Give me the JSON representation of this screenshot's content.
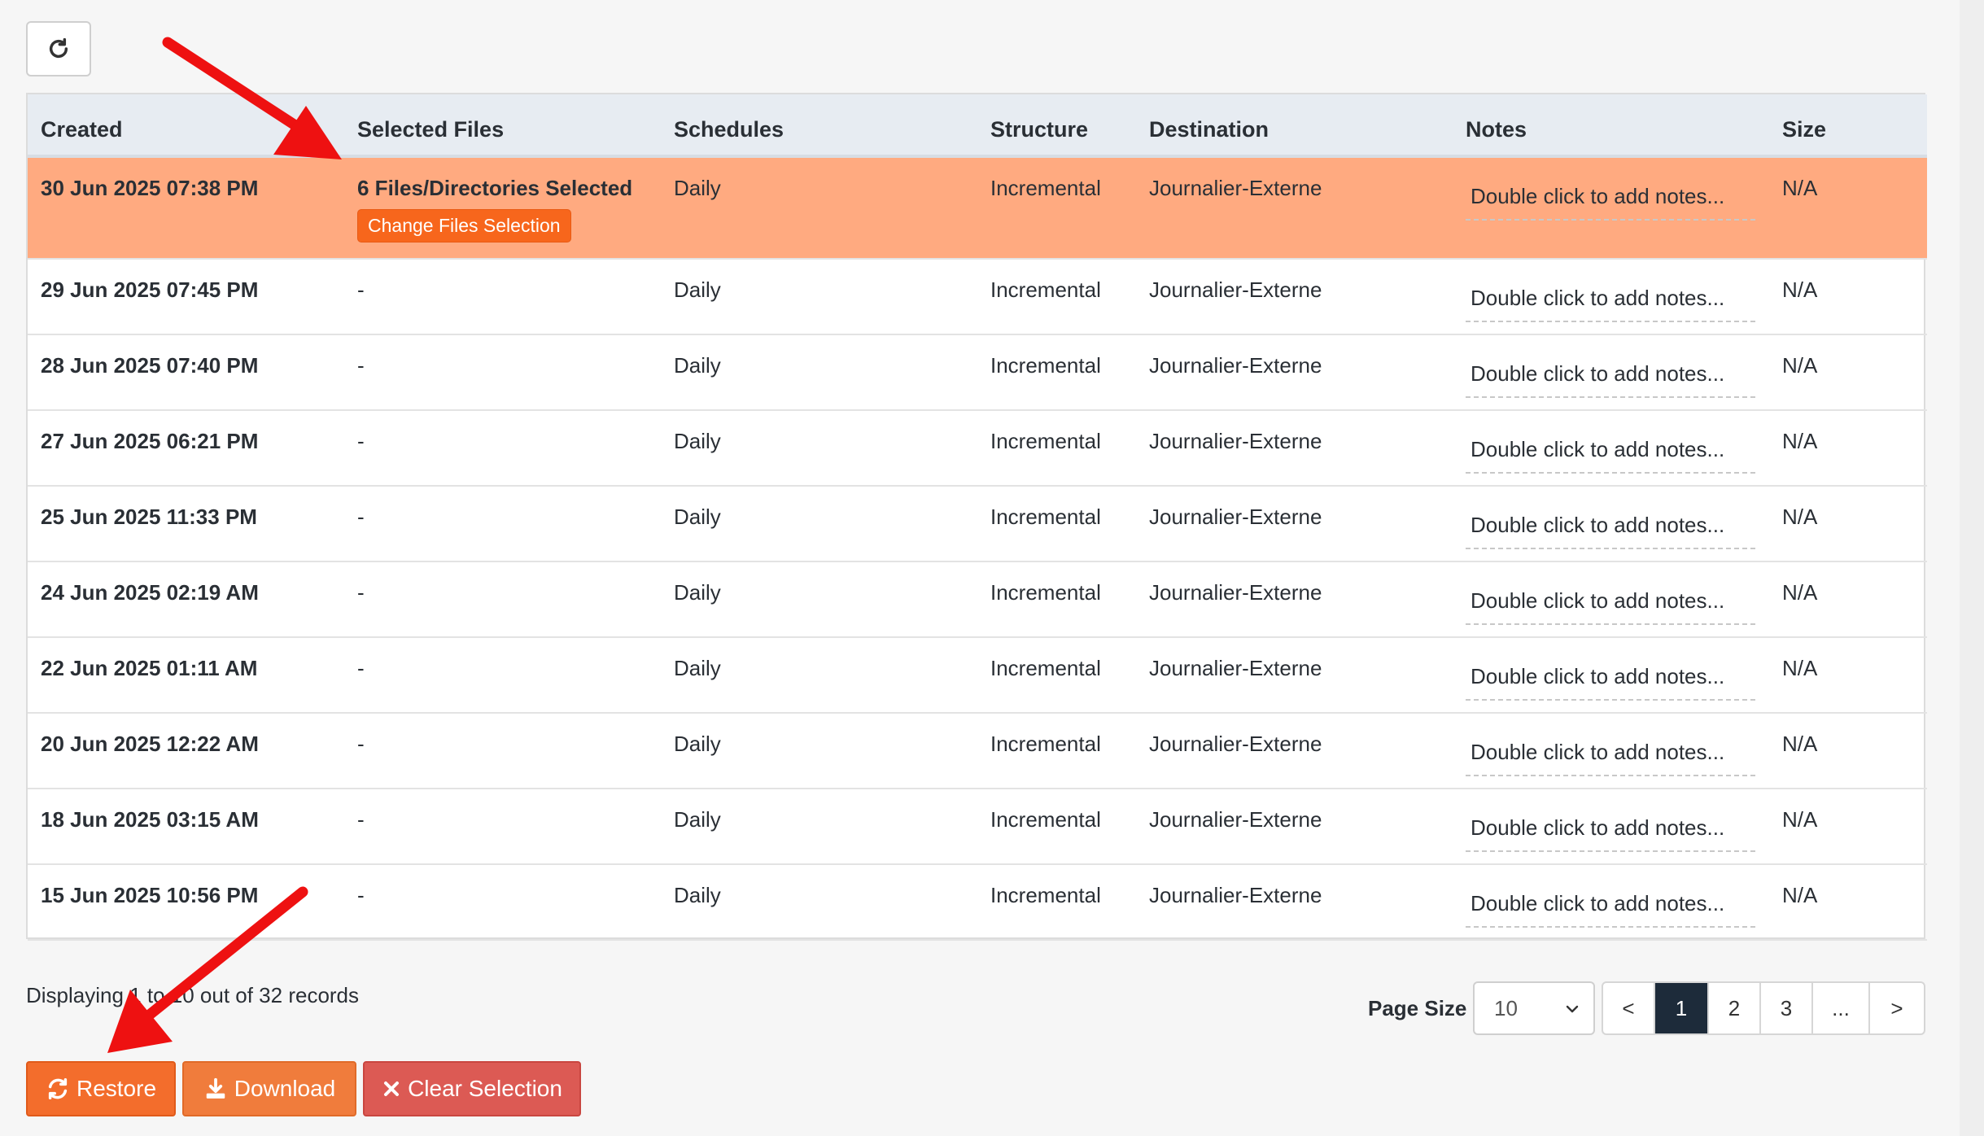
{
  "toolbar": {
    "refresh_icon": "refresh-icon"
  },
  "table": {
    "headers": [
      "Created",
      "Selected Files",
      "Schedules",
      "Structure",
      "Destination",
      "Notes",
      "Size"
    ],
    "change_files_label": "Change Files Selection",
    "rows": [
      {
        "created": "30 Jun 2025 07:38 PM",
        "files": "6 Files/Directories Selected",
        "schedule": "Daily",
        "structure": "Incremental",
        "destination": "Journalier-Externe",
        "notes": "Double click to add notes...",
        "size": "N/A"
      },
      {
        "created": "29 Jun 2025 07:45 PM",
        "files": "-",
        "schedule": "Daily",
        "structure": "Incremental",
        "destination": "Journalier-Externe",
        "notes": "Double click to add notes...",
        "size": "N/A"
      },
      {
        "created": "28 Jun 2025 07:40 PM",
        "files": "-",
        "schedule": "Daily",
        "structure": "Incremental",
        "destination": "Journalier-Externe",
        "notes": "Double click to add notes...",
        "size": "N/A"
      },
      {
        "created": "27 Jun 2025 06:21 PM",
        "files": "-",
        "schedule": "Daily",
        "structure": "Incremental",
        "destination": "Journalier-Externe",
        "notes": "Double click to add notes...",
        "size": "N/A"
      },
      {
        "created": "25 Jun 2025 11:33 PM",
        "files": "-",
        "schedule": "Daily",
        "structure": "Incremental",
        "destination": "Journalier-Externe",
        "notes": "Double click to add notes...",
        "size": "N/A"
      },
      {
        "created": "24 Jun 2025 02:19 AM",
        "files": "-",
        "schedule": "Daily",
        "structure": "Incremental",
        "destination": "Journalier-Externe",
        "notes": "Double click to add notes...",
        "size": "N/A"
      },
      {
        "created": "22 Jun 2025 01:11 AM",
        "files": "-",
        "schedule": "Daily",
        "structure": "Incremental",
        "destination": "Journalier-Externe",
        "notes": "Double click to add notes...",
        "size": "N/A"
      },
      {
        "created": "20 Jun 2025 12:22 AM",
        "files": "-",
        "schedule": "Daily",
        "structure": "Incremental",
        "destination": "Journalier-Externe",
        "notes": "Double click to add notes...",
        "size": "N/A"
      },
      {
        "created": "18 Jun 2025 03:15 AM",
        "files": "-",
        "schedule": "Daily",
        "structure": "Incremental",
        "destination": "Journalier-Externe",
        "notes": "Double click to add notes...",
        "size": "N/A"
      },
      {
        "created": "15 Jun 2025 10:56 PM",
        "files": "-",
        "schedule": "Daily",
        "structure": "Incremental",
        "destination": "Journalier-Externe",
        "notes": "Double click to add notes...",
        "size": "N/A"
      }
    ]
  },
  "footer": {
    "displaying_text": "Displaying 1 to 10 out of 32 records",
    "page_size_label": "Page Size",
    "page_size_value": "10",
    "pages": [
      "<",
      "1",
      "2",
      "3",
      "...",
      ">"
    ],
    "active_page": "1"
  },
  "actions": {
    "restore_label": "Restore",
    "download_label": "Download",
    "clear_label": "Clear Selection"
  },
  "colors": {
    "selected_row": "#ffaa80",
    "accent_orange": "#f36d2c",
    "clear_red": "#dc5a54",
    "active_page": "#1d2b3a",
    "annotation_arrow": "#ee1111"
  }
}
